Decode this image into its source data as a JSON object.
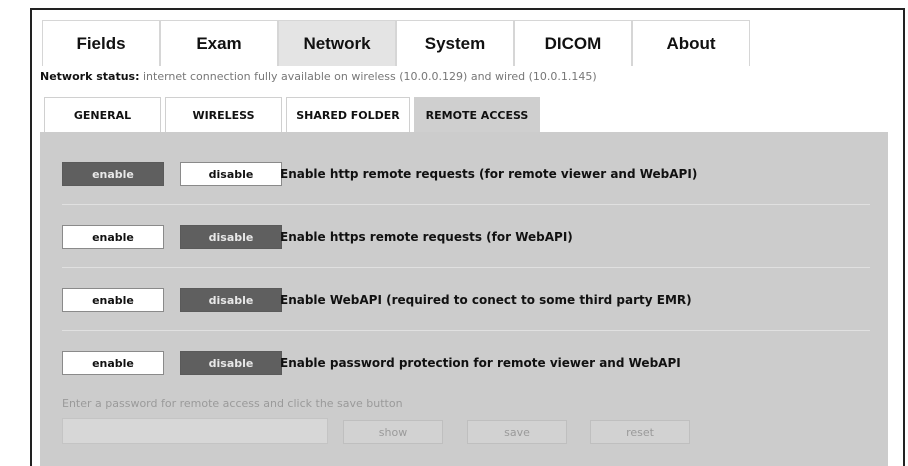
{
  "top_tabs": [
    {
      "label": "Fields",
      "active": false
    },
    {
      "label": "Exam",
      "active": false
    },
    {
      "label": "Network",
      "active": true
    },
    {
      "label": "System",
      "active": false
    },
    {
      "label": "DICOM",
      "active": false
    },
    {
      "label": "About",
      "active": false
    }
  ],
  "status": {
    "label": "Network status:",
    "value": " internet connection fully available on wireless (10.0.0.129) and wired (10.0.1.145)"
  },
  "sub_tabs": [
    {
      "label": "GENERAL",
      "active": false
    },
    {
      "label": "WIRELESS",
      "active": false
    },
    {
      "label": "SHARED FOLDER",
      "active": false
    },
    {
      "label": "REMOTE ACCESS",
      "active": true
    }
  ],
  "rows": [
    {
      "enable": "enable",
      "disable": "disable",
      "state": "enable",
      "label": "Enable http remote requests (for remote viewer and WebAPI)"
    },
    {
      "enable": "enable",
      "disable": "disable",
      "state": "disable",
      "label": "Enable https remote requests (for WebAPI)"
    },
    {
      "enable": "enable",
      "disable": "disable",
      "state": "disable",
      "label": "Enable WebAPI (required to conect to some third party EMR)"
    },
    {
      "enable": "enable",
      "disable": "disable",
      "state": "disable",
      "label": "Enable password protection for remote viewer and WebAPI"
    }
  ],
  "password": {
    "hint": "Enter a password for remote access and click the save button",
    "value": "",
    "show": "show",
    "save": "save",
    "reset": "reset"
  },
  "colors": {
    "active_toggle": "#5f5f5f",
    "panel": "#cccccc"
  }
}
